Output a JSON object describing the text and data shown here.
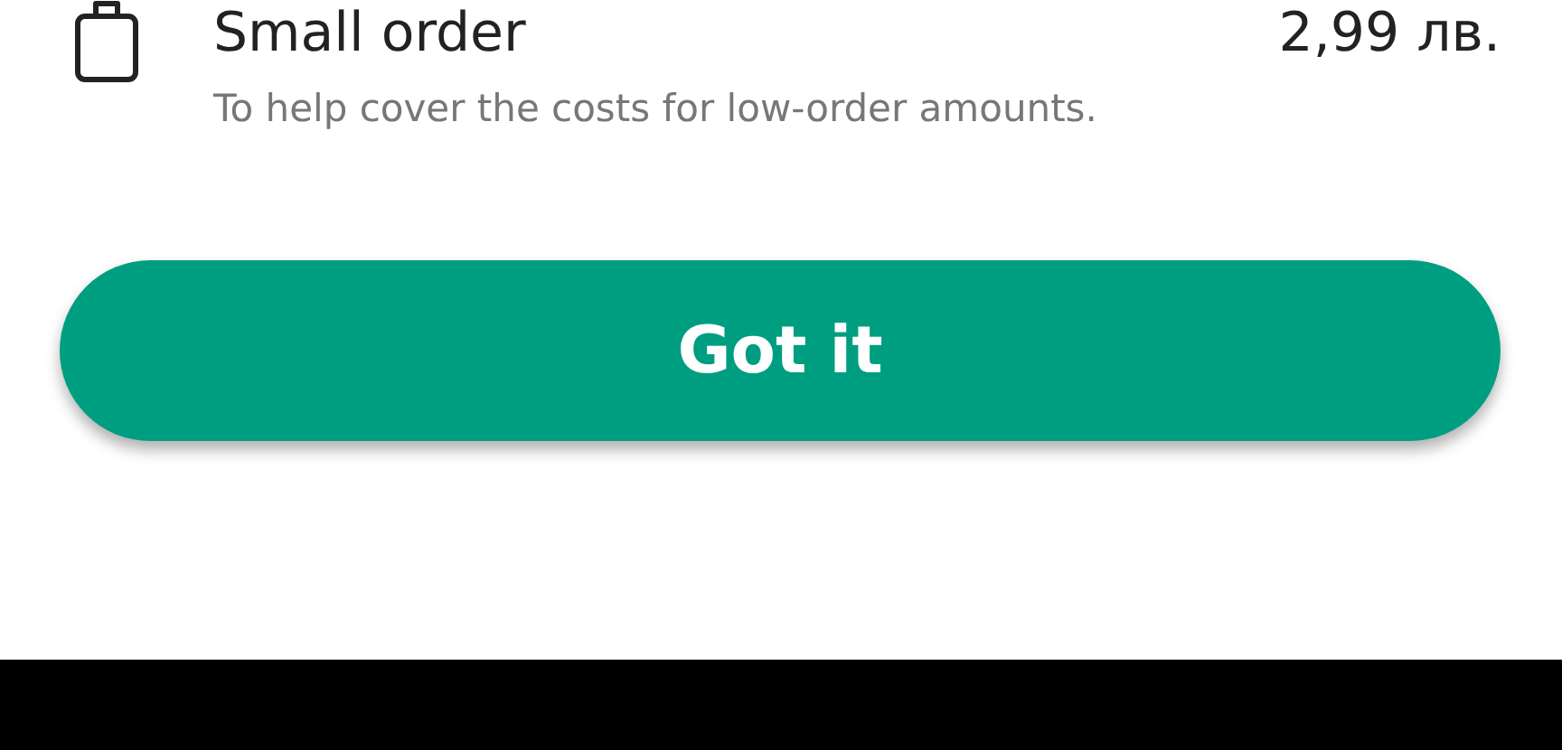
{
  "fee": {
    "title": "Small order",
    "price": "2,99 лв.",
    "description": "To help cover the costs for low-order amounts."
  },
  "button": {
    "label": "Got it"
  }
}
